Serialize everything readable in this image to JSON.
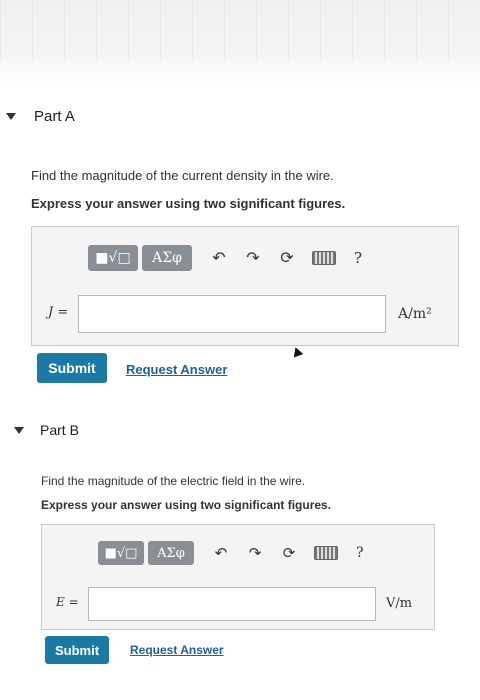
{
  "part_a": {
    "title": "Part A",
    "question": "Find the magnitude of the current density in the wire.",
    "instruction": "Express your answer using two significant figures.",
    "toolbar": {
      "templates_label": "■√□",
      "greek_label": "ΑΣφ",
      "help_label": "?"
    },
    "variable_label": "J =",
    "input_value": "",
    "unit": "A/m²",
    "submit_label": "Submit",
    "request_label": "Request Answer"
  },
  "part_b": {
    "title": "Part B",
    "question": "Find the magnitude of the electric field in the wire.",
    "instruction": "Express your answer using two significant figures.",
    "toolbar": {
      "templates_label": "■√□",
      "greek_label": "ΑΣφ",
      "help_label": "?"
    },
    "variable_label": "E =",
    "input_value": "",
    "unit": "V/m",
    "submit_label": "Submit",
    "request_label": "Request Answer"
  }
}
